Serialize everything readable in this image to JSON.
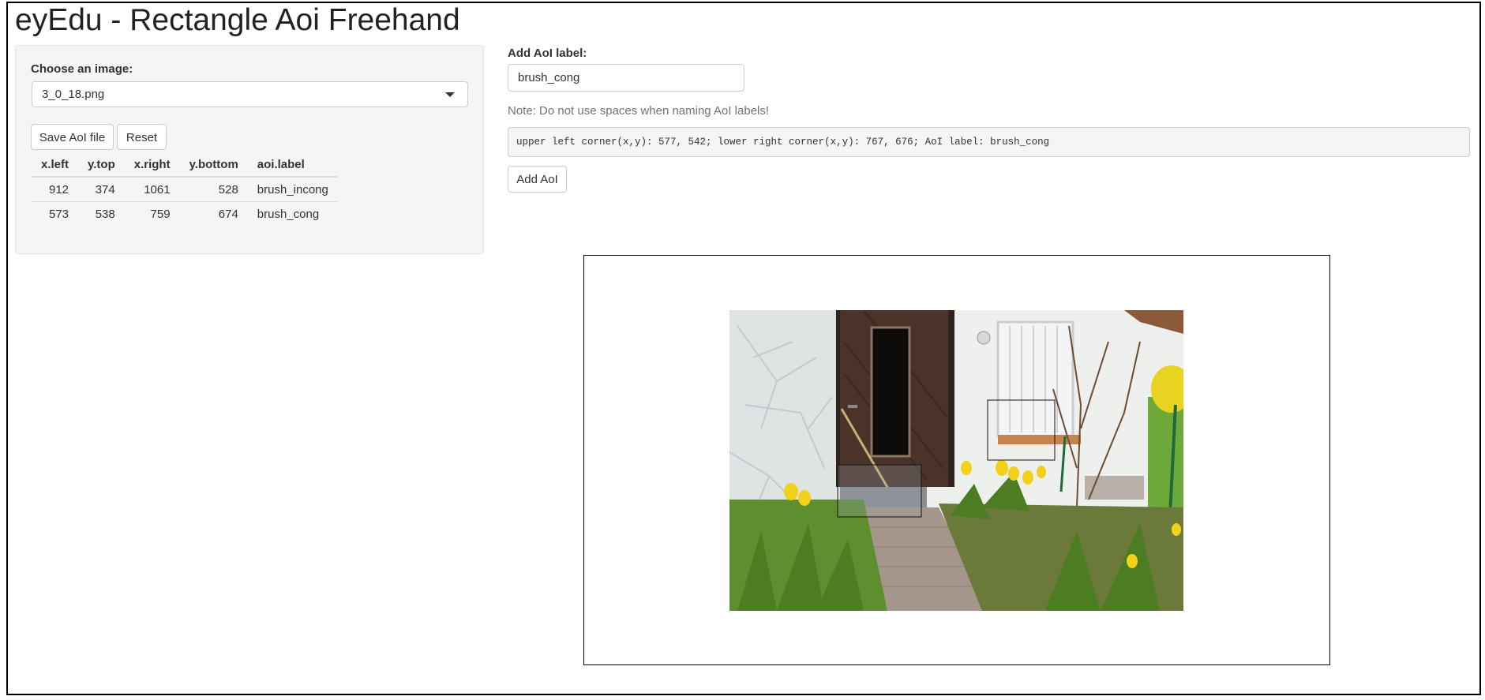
{
  "app": {
    "title": "eyEdu - Rectangle Aoi Freehand"
  },
  "sidebar": {
    "choose_label": "Choose an image:",
    "selected_image": "3_0_18.png",
    "save_button": "Save AoI file",
    "reset_button": "Reset",
    "table": {
      "headers": [
        "x.left",
        "y.top",
        "x.right",
        "y.bottom",
        "aoi.label"
      ],
      "rows": [
        [
          "912",
          "374",
          "1061",
          "528",
          "brush_incong"
        ],
        [
          "573",
          "538",
          "759",
          "674",
          "brush_cong"
        ]
      ]
    }
  },
  "main": {
    "add_label": "Add AoI label:",
    "aoi_input_value": "brush_cong",
    "note": "Note: Do not use spaces when naming AoI labels!",
    "coords_text": "upper left corner(x,y): 577, 542; lower right corner(x,y): 767, 676; AoI label: brush_cong",
    "add_button": "Add AoI"
  },
  "colors": {
    "panel_bg": "#f5f5f5",
    "border": "#cccccc",
    "wall": "#eef0ee",
    "door": "#4a3328",
    "grass": "#5e8e2e",
    "tulip": "#f2d11a",
    "path": "#a5958a"
  },
  "icons": {
    "select_caret": "chevron-down-icon"
  }
}
